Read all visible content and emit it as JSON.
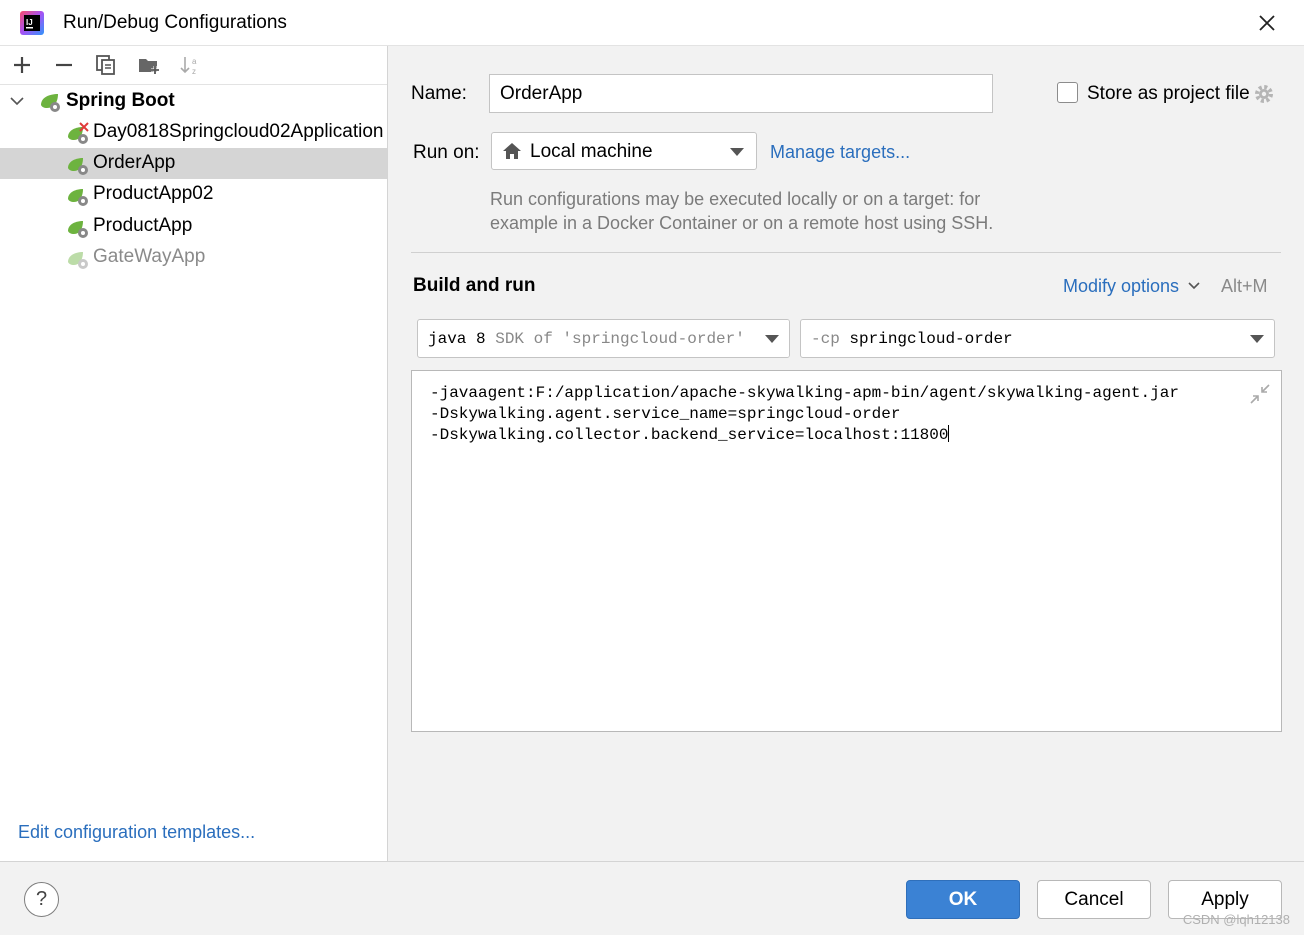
{
  "window": {
    "title": "Run/Debug Configurations"
  },
  "sidebar": {
    "group": {
      "label": "Spring Boot"
    },
    "items": [
      {
        "label": "Day0818Springcloud02Application",
        "state": "error"
      },
      {
        "label": "OrderApp",
        "state": "selected"
      },
      {
        "label": "ProductApp02",
        "state": "normal"
      },
      {
        "label": "ProductApp",
        "state": "normal"
      },
      {
        "label": "GateWayApp",
        "state": "disabled"
      }
    ],
    "edit_templates_link": "Edit configuration templates..."
  },
  "form": {
    "name_label": "Name:",
    "name_value": "OrderApp",
    "store_project_file_label": "Store as project file",
    "run_on_label": "Run on:",
    "run_on_value": "Local machine",
    "manage_targets_link": "Manage targets...",
    "hint_line1": "Run configurations may be executed locally or on a target: for",
    "hint_line2": "example in a Docker Container or on a remote host using SSH.",
    "section_title": "Build and run",
    "modify_options_link": "Modify options",
    "modify_options_shortcut": "Alt+M",
    "jdk_value_main": "java 8",
    "jdk_value_rest": " SDK of 'springcloud-order' moc",
    "cp_prefix": "-cp",
    "cp_value": "springcloud-order",
    "vm_options": [
      "-javaagent:F:/application/apache-skywalking-apm-bin/agent/skywalking-agent.jar",
      "-Dskywalking.agent.service_name=springcloud-order",
      "-Dskywalking.collector.backend_service=localhost:11800"
    ]
  },
  "buttons": {
    "help": "?",
    "ok": "OK",
    "cancel": "Cancel",
    "apply": "Apply"
  },
  "watermark": "CSDN @lqh12138",
  "colors": {
    "accent": "#3b82d4",
    "link": "#2a6ebd",
    "spring_green": "#6db33f",
    "selection": "#d5d5d5"
  }
}
